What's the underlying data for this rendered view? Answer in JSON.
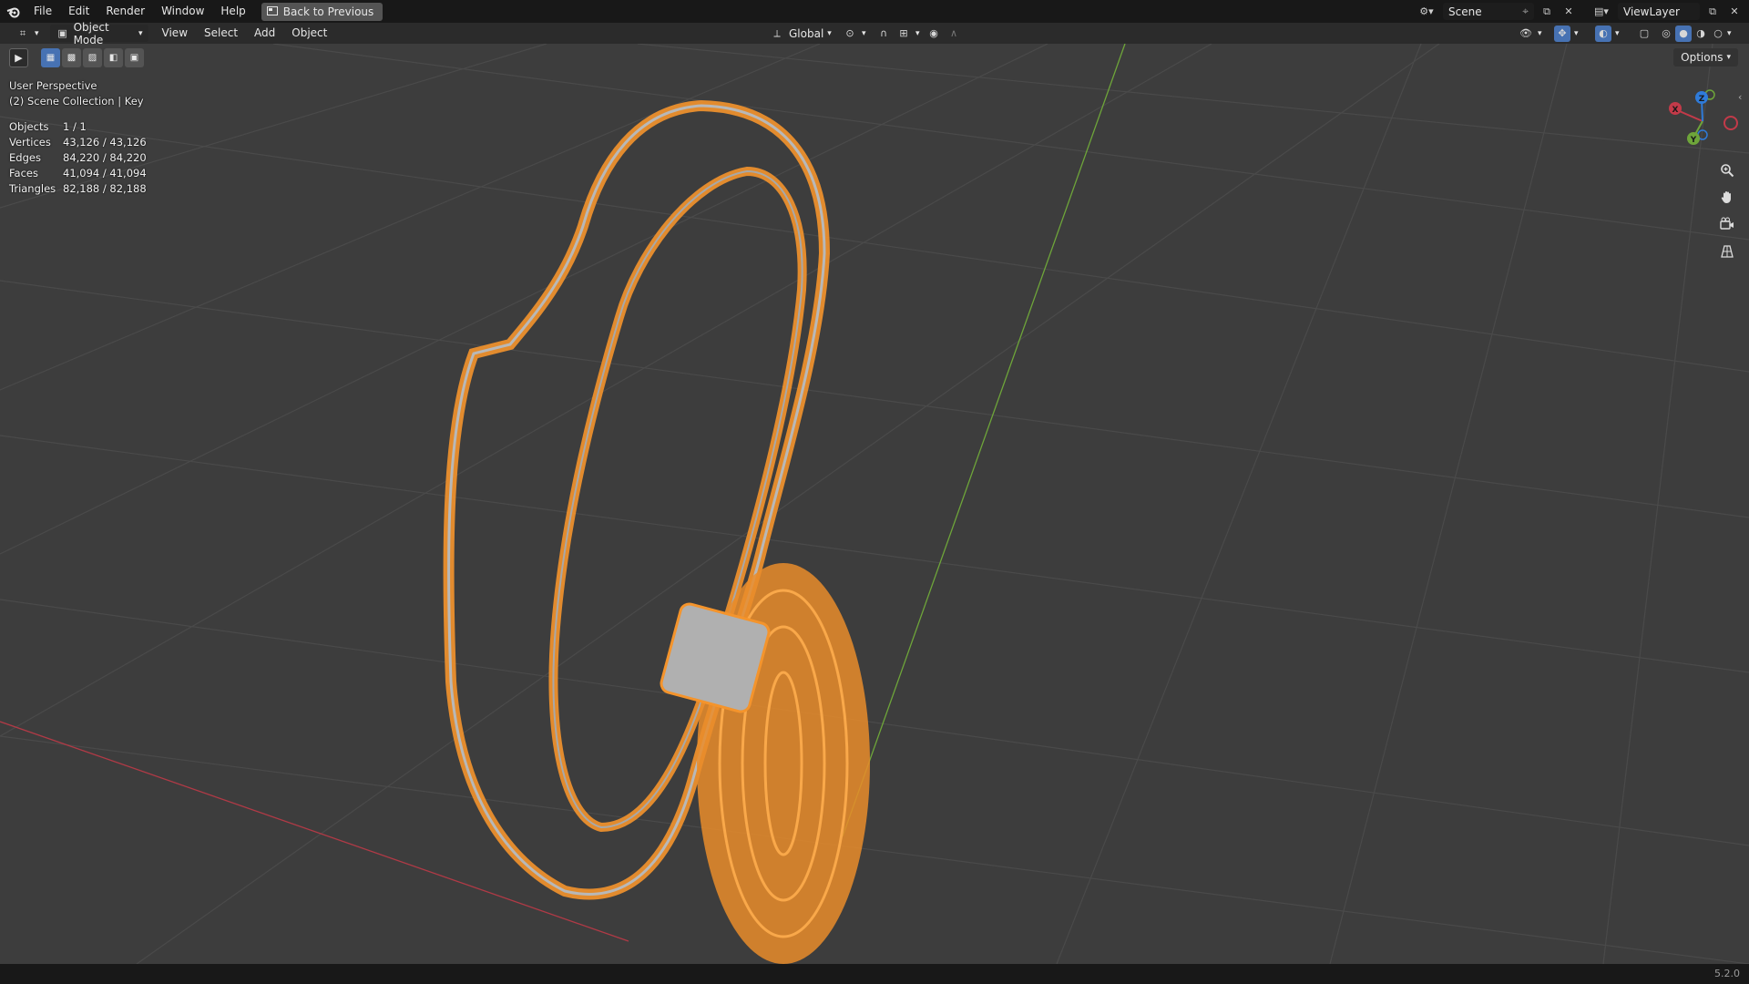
{
  "menu": {
    "file": "File",
    "edit": "Edit",
    "render": "Render",
    "window": "Window",
    "help": "Help",
    "back_to_previous": "Back to Previous"
  },
  "topright": {
    "scene": "Scene",
    "view_layer": "ViewLayer"
  },
  "header": {
    "mode": "Object Mode",
    "view": "View",
    "select": "Select",
    "add": "Add",
    "object": "Object",
    "orientation": "Global",
    "options": "Options"
  },
  "overlay": {
    "perspective": "User Perspective",
    "collection": "(2) Scene Collection | Key"
  },
  "stats": [
    {
      "label": "Objects",
      "value": "1 / 1"
    },
    {
      "label": "Vertices",
      "value": "43,126 / 43,126"
    },
    {
      "label": "Edges",
      "value": "84,220 / 84,220"
    },
    {
      "label": "Faces",
      "value": "41,094 / 41,094"
    },
    {
      "label": "Triangles",
      "value": "82,188 / 82,188"
    }
  ],
  "gizmo": {
    "x": "X",
    "y": "Y",
    "z": "Z"
  },
  "status": {
    "version": "5.2.0"
  },
  "colors": {
    "selection": "#f4942c",
    "grid_bg": "#3d3d3d",
    "x_axis": "#c33a49",
    "y_axis": "#6ea53a",
    "active_tool": "#4772b3"
  },
  "icons": [
    "blender-icon",
    "editor-type-icon",
    "object-mode-icon",
    "orientation-icon",
    "snap-icon",
    "proportional-icon",
    "zoom-icon",
    "hand-icon",
    "camera-icon",
    "grid-icon"
  ]
}
